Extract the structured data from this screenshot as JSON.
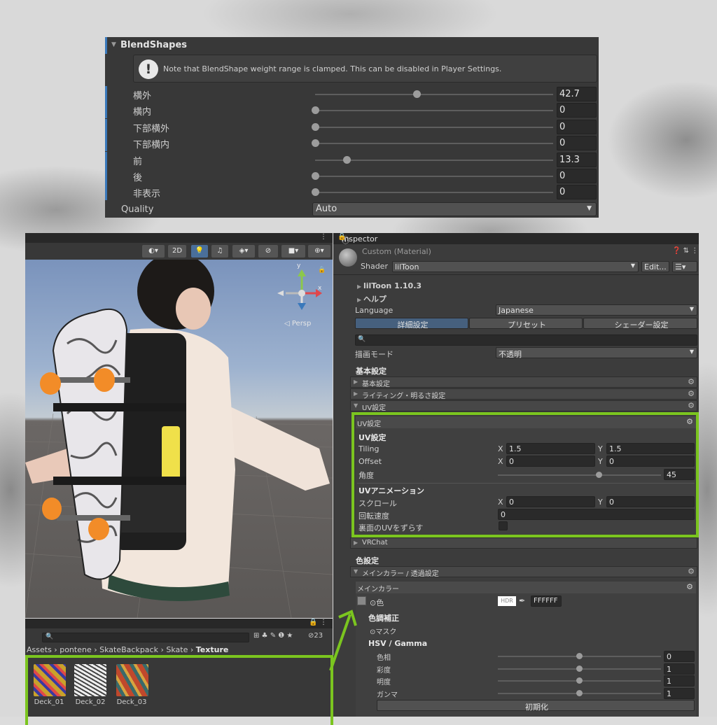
{
  "blendshapes": {
    "title": "BlendShapes",
    "note": "Note that BlendShape weight range is clamped. This can be disabled in Player Settings.",
    "rows": [
      {
        "label": "横外",
        "value": "42.7",
        "fraction": 0.427
      },
      {
        "label": "横内",
        "value": "0",
        "fraction": 0
      },
      {
        "label": "下部横外",
        "value": "0",
        "fraction": 0
      },
      {
        "label": "下部横内",
        "value": "0",
        "fraction": 0
      },
      {
        "label": "前",
        "value": "13.3",
        "fraction": 0.133
      },
      {
        "label": "後",
        "value": "0",
        "fraction": 0
      },
      {
        "label": "非表示",
        "value": "0",
        "fraction": 0
      }
    ],
    "quality_label": "Quality",
    "quality_value": "Auto"
  },
  "scene": {
    "toolbar_2d": "2D",
    "persp_label": "◁ Persp",
    "gizmo_y": "y",
    "gizmo_x": "x",
    "colors": {
      "board": "#e8e6ea",
      "wheel": "#f28c28",
      "bag": "#1f1f1f",
      "shirt": "#f2e6dc",
      "phone": "#f0e04a"
    }
  },
  "project": {
    "count": "23",
    "breadcrumb": [
      "Assets",
      "pontene",
      "SkateBackpack",
      "Skate"
    ],
    "breadcrumb_current": "Texture",
    "assets": [
      "Deck_01",
      "Deck_02",
      "Deck_03"
    ]
  },
  "inspector": {
    "tab": "Inspector",
    "material_name": "Custom (Material)",
    "shader_label": "Shader",
    "shader_value": "lilToon",
    "edit_button": "Edit...",
    "version": "lilToon 1.10.3",
    "help": "ヘルプ",
    "language_label": "Language",
    "language_value": "Japanese",
    "tabs": [
      "詳細設定",
      "プリセット",
      "シェーダー設定"
    ],
    "render_mode_label": "描画モード",
    "render_mode_value": "不透明",
    "basic_header": "基本設定",
    "folds": [
      "基本設定",
      "ライティング・明るさ設定",
      "UV設定"
    ],
    "uv": {
      "box_title": "UV設定",
      "section": "UV設定",
      "tiling_label": "Tiling",
      "tiling_x": "1.5",
      "tiling_y": "1.5",
      "offset_label": "Offset",
      "offset_x": "0",
      "offset_y": "0",
      "angle_label": "角度",
      "angle_value": "45",
      "anim_section": "UVアニメーション",
      "scroll_label": "スクロール",
      "scroll_x": "0",
      "scroll_y": "0",
      "rot_label": "回転速度",
      "rot_value": "0",
      "back_label": "裏面のUVをずらす",
      "x": "X",
      "y": "Y"
    },
    "vrchat": "VRChat",
    "color_header": "色設定",
    "main_fold": "メインカラー / 透過設定",
    "main_box": "メインカラー",
    "color_label": "⊙色",
    "hdr": "HDR",
    "hex": "FFFFFF",
    "tone_header": "色調補正",
    "mask_label": "⊙マスク",
    "hsv_header": "HSV / Gamma",
    "hsv": [
      {
        "label": "色相",
        "value": "0"
      },
      {
        "label": "彩度",
        "value": "1"
      },
      {
        "label": "明度",
        "value": "1"
      },
      {
        "label": "ガンマ",
        "value": "1"
      }
    ],
    "reset_button": "初期化"
  },
  "colors": {
    "highlight": "#7bc51f",
    "panel": "#383838",
    "accent": "#3a79bb"
  }
}
